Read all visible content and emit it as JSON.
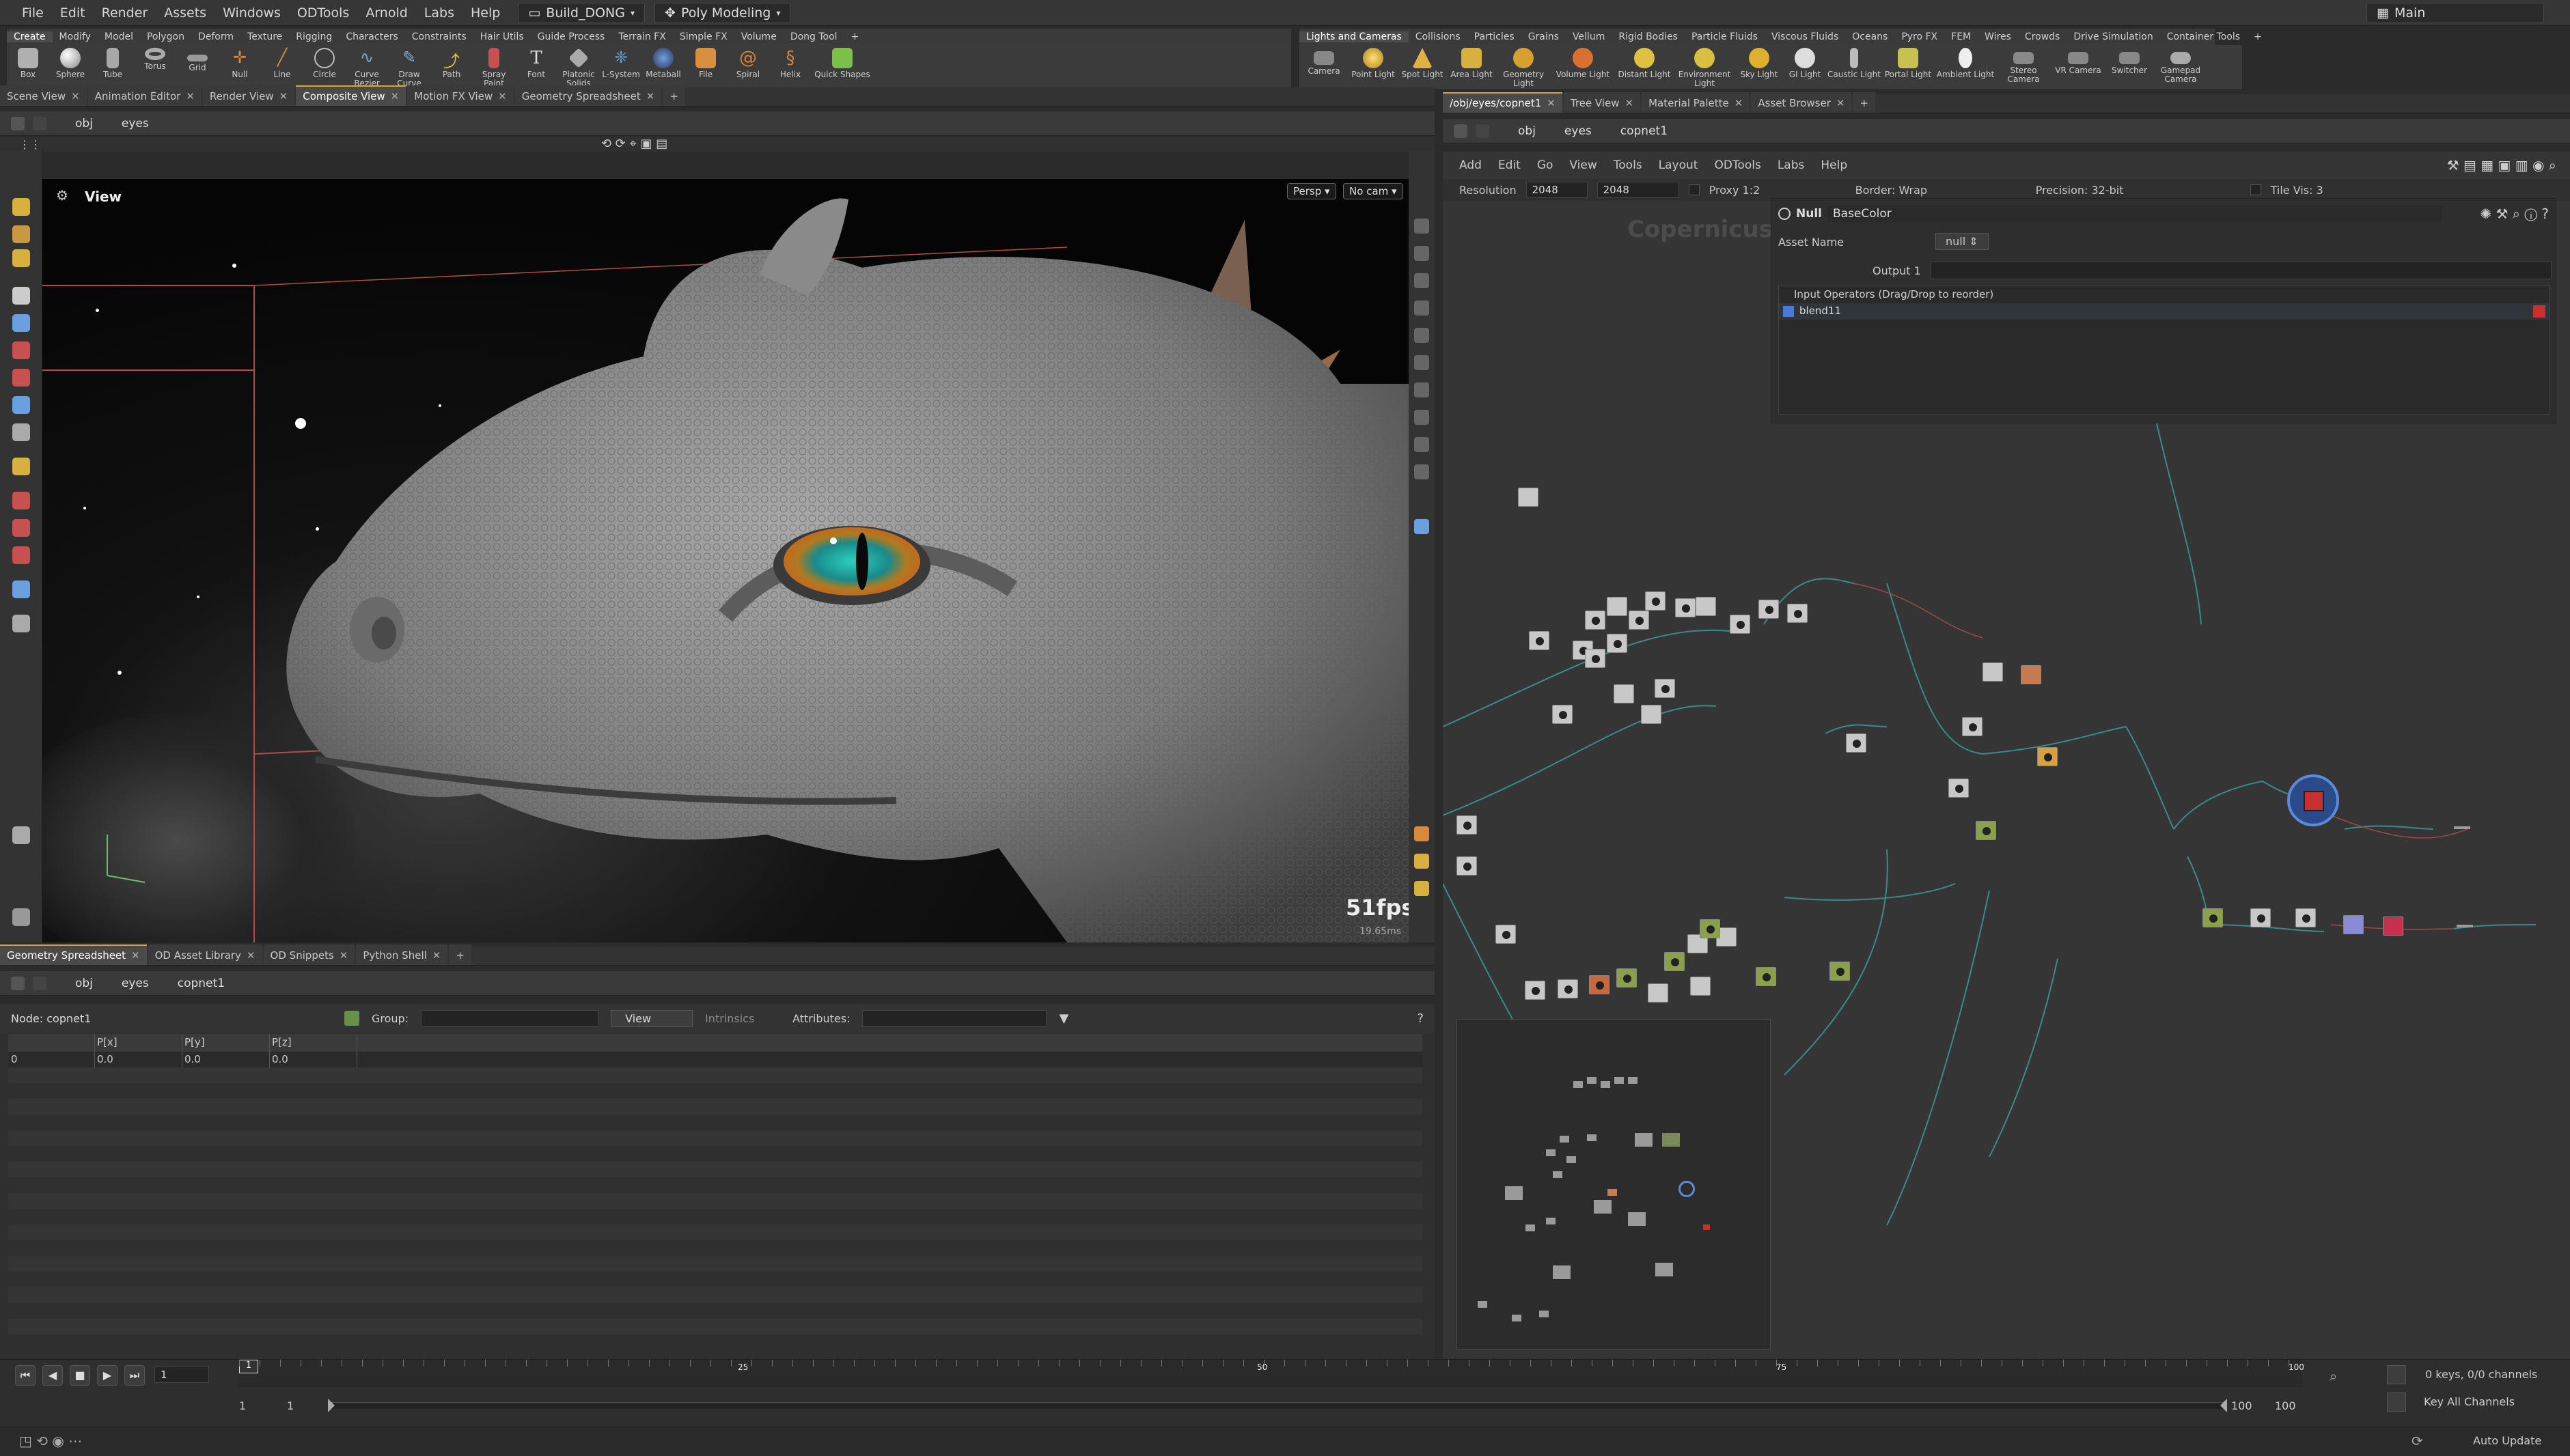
{
  "menu": {
    "items": [
      "File",
      "Edit",
      "Render",
      "Assets",
      "Windows",
      "ODTools",
      "Arnold",
      "Labs",
      "Help"
    ],
    "build": "Build_DONG",
    "desktop": "Poly Modeling",
    "main": "Main"
  },
  "shelf_left": {
    "tabs": [
      "Create",
      "Modify",
      "Model",
      "Polygon",
      "Deform",
      "Texture",
      "Rigging",
      "Characters",
      "Constraints",
      "Hair Utils",
      "Guide Process",
      "Terrain FX",
      "Simple FX",
      "Volume",
      "Dong Tool"
    ],
    "tools": [
      "Box",
      "Sphere",
      "Tube",
      "Torus",
      "Grid",
      "Null",
      "Line",
      "Circle",
      "Curve Bezier",
      "Draw Curve",
      "Path",
      "Spray Paint",
      "Font",
      "Platonic Solids",
      "L-System",
      "Metaball",
      "File",
      "Spiral",
      "Helix",
      "Quick Shapes"
    ]
  },
  "shelf_right": {
    "tabs": [
      "Lights and Cameras",
      "Collisions",
      "Particles",
      "Grains",
      "Vellum",
      "Rigid Bodies",
      "Particle Fluids",
      "Viscous Fluids",
      "Oceans",
      "Pyro FX",
      "FEM",
      "Wires",
      "Crowds",
      "Drive Simulation",
      "Container Tools"
    ],
    "tools": [
      "Camera",
      "Point Light",
      "Spot Light",
      "Area Light",
      "Geometry Light",
      "Volume Light",
      "Distant Light",
      "Environment Light",
      "Sky Light",
      "GI Light",
      "Caustic Light",
      "Portal Light",
      "Ambient Light",
      "Stereo Camera",
      "VR Camera",
      "Switcher",
      "Gamepad Camera"
    ]
  },
  "viewer_tabs": [
    "Scene View",
    "Animation Editor",
    "Render View",
    "Composite View",
    "Motion FX View",
    "Geometry Spreadsheet"
  ],
  "viewer_path": [
    "obj",
    "eyes"
  ],
  "viewport": {
    "label": "View",
    "persp": "Persp",
    "cam": "No cam",
    "fps": "51fps",
    "ms": "19.65ms"
  },
  "lower_tabs": [
    "Geometry Spreadsheet",
    "OD Asset Library",
    "OD Snippets",
    "Python Shell"
  ],
  "lower_path": [
    "obj",
    "eyes",
    "copnet1"
  ],
  "sheet": {
    "node": "Node: copnet1",
    "group_label": "Group:",
    "view": "View",
    "intrinsics": "Intrinsics",
    "attributes": "Attributes:",
    "columns": [
      "P[x]",
      "P[y]",
      "P[z]"
    ],
    "row": {
      "index": "0",
      "x": "0.0",
      "y": "0.0",
      "z": "0.0"
    }
  },
  "right_tabs": [
    "/obj/eyes/copnet1",
    "Tree View",
    "Material Palette",
    "Asset Browser"
  ],
  "right_path": [
    "obj",
    "eyes",
    "copnet1"
  ],
  "net_menu": [
    "Add",
    "Edit",
    "Go",
    "View",
    "Tools",
    "Layout",
    "ODTools",
    "Labs",
    "Help"
  ],
  "net_bar": {
    "resolution_label": "Resolution",
    "res_x": "2048",
    "res_y": "2048",
    "proxy": "Proxy 1:2",
    "border": "Border: Wrap",
    "precision": "Precision: 32-bit",
    "tilevis": "Tile Vis: 3"
  },
  "network_label": "Copernicus",
  "param": {
    "type": "Null",
    "name": "BaseColor",
    "asset_label": "Asset Name",
    "asset_value": "null",
    "output_label": "Output 1",
    "inputs_label": "Input Operators (Drag/Drop to reorder)",
    "input": "blend11"
  },
  "timeline": {
    "frame": "1",
    "start": "1",
    "start2": "1",
    "end": "100",
    "end2": "100",
    "ticks": [
      "1",
      "25",
      "50",
      "75",
      "100"
    ],
    "keys": "0 keys, 0/0 channels",
    "keyall": "Key All Channels",
    "auto": "Auto Update"
  },
  "colors": {
    "accent": "#d8a13c",
    "bg": "#2b2b2b",
    "panel": "#353535"
  }
}
